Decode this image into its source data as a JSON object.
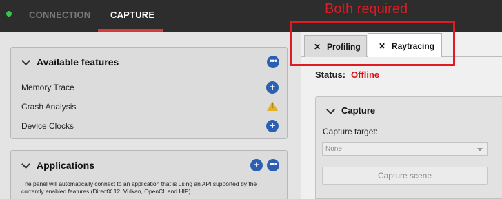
{
  "nav": {
    "tabs": [
      {
        "label": "CONNECTION"
      },
      {
        "label": "CAPTURE"
      }
    ],
    "status_color": "#34c84a",
    "active_underline_color": "#d63a3a"
  },
  "features_panel": {
    "title": "Available features",
    "items": [
      {
        "label": "Memory Trace",
        "action_icon": "add-circle-icon"
      },
      {
        "label": "Crash Analysis",
        "action_icon": "warning-icon"
      },
      {
        "label": "Device Clocks",
        "action_icon": "add-circle-icon"
      }
    ]
  },
  "apps_panel": {
    "title": "Applications",
    "description": "The panel will automatically connect to an application that is using an API supported by the currently enabled features (DirectX 12, Vulkan, OpenCL and HIP)."
  },
  "right_tabs": [
    {
      "label": "Profiling",
      "close": "✕"
    },
    {
      "label": "Raytracing",
      "close": "✕"
    }
  ],
  "status": {
    "label": "Status:",
    "value": "Offline",
    "value_color": "#e01010"
  },
  "capture": {
    "title": "Capture",
    "target_label": "Capture target:",
    "target_value": "None",
    "button_label": "Capture scene"
  },
  "annotation": {
    "text": "Both required",
    "color": "#e01b24"
  }
}
